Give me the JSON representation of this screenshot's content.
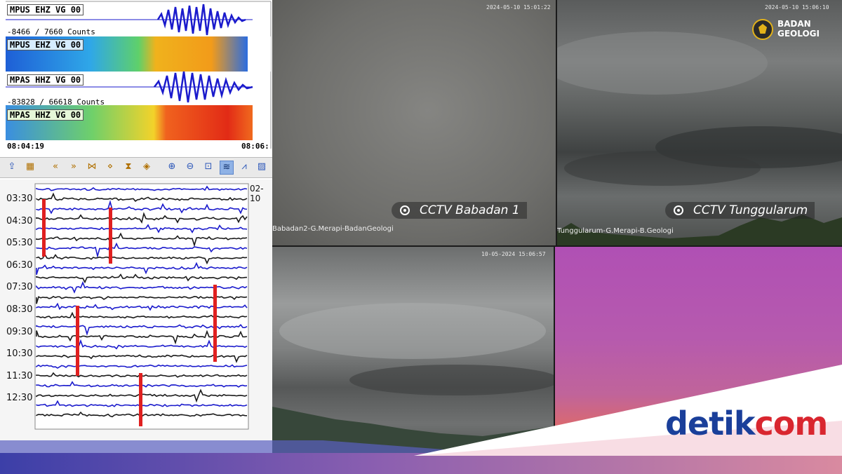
{
  "seismograph": {
    "traces": [
      {
        "label": "MPUS EHZ VG 00",
        "counts": "-8466 / 7660 Counts"
      },
      {
        "label": "MPUS EHZ VG 00"
      },
      {
        "label": "MPAS HHZ VG 00",
        "counts": "-83828 / 66618 Counts"
      },
      {
        "label": "MPAS HHZ VG 00"
      }
    ],
    "time_start": "08:04:19",
    "time_end": "08:06:",
    "date_tag": "02-10",
    "hours": [
      "03:30",
      "04:30",
      "05:30",
      "06:30",
      "07:30",
      "08:30",
      "09:30",
      "10:30",
      "11:30",
      "12:30"
    ],
    "toolbar_icons": [
      "export-icon",
      "table-icon",
      "rewind-icon",
      "back-icon",
      "shrink-icon",
      "expand-icon",
      "hourglass-icon",
      "compress-icon",
      "zoom-in-icon",
      "zoom-out-icon",
      "fit-icon",
      "waveform-icon",
      "spectrum-icon",
      "spectrogram-icon"
    ]
  },
  "cameras": [
    {
      "name": "CCTV Babadan 1",
      "sub": "Babadan2-G.Merapi-BadanGeologi",
      "timestamp": "2024-05-10 15:01:22"
    },
    {
      "name": "CCTV Tunggularum",
      "sub": "Tunggularum-G.Merapi-B.Geologi",
      "timestamp": "2024-05-10 15:06:10"
    },
    {
      "timestamp": "10-05-2024 15:06:57"
    },
    {}
  ],
  "logo_badan": {
    "line1": "BADAN",
    "line2": "GEOLOGI"
  },
  "brand": {
    "part1": "detik",
    "part2": "com"
  },
  "colors": {
    "brand_blue": "#1a3f9a",
    "brand_red": "#d9262f",
    "trace_blue": "#1a1acc",
    "event_red": "#e02020"
  }
}
